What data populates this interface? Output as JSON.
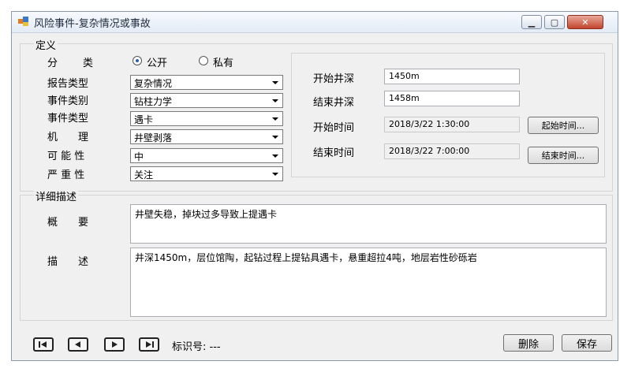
{
  "window": {
    "title": "风险事件-复杂情况或事故"
  },
  "definition": {
    "group_label": "定义",
    "classification": {
      "label": "分　　类",
      "options": [
        "公开",
        "私有"
      ],
      "selected": "公开"
    },
    "fields": [
      {
        "label": "报告类型",
        "value": "复杂情况"
      },
      {
        "label": "事件类别",
        "value": "钻柱力学"
      },
      {
        "label": "事件类型",
        "value": "遇卡"
      },
      {
        "label": "机　　理",
        "value": "井壁剥落"
      },
      {
        "label": "可 能 性",
        "value": "中"
      },
      {
        "label": "严 重 性",
        "value": "关注"
      }
    ],
    "start_depth": {
      "label": "开始井深",
      "value": "1450m"
    },
    "end_depth": {
      "label": "结束井深",
      "value": "1458m"
    },
    "start_time": {
      "label": "开始时间",
      "value": "2018/3/22 1:30:00",
      "button": "起始时间..."
    },
    "end_time": {
      "label": "结束时间",
      "value": "2018/3/22 7:00:00",
      "button": "结束时间..."
    }
  },
  "details": {
    "group_label": "详细描述",
    "summary": {
      "label": "概　　要",
      "value": "井壁失稳，掉块过多导致上提遇卡"
    },
    "description": {
      "label": "描　　述",
      "value": "井深1450m，层位馆陶，起钻过程上提钻具遇卡，悬重超拉4吨，地层岩性砂砾岩"
    }
  },
  "footer": {
    "id_label": "标识号: ---",
    "delete_label": "删除",
    "save_label": "保存"
  }
}
